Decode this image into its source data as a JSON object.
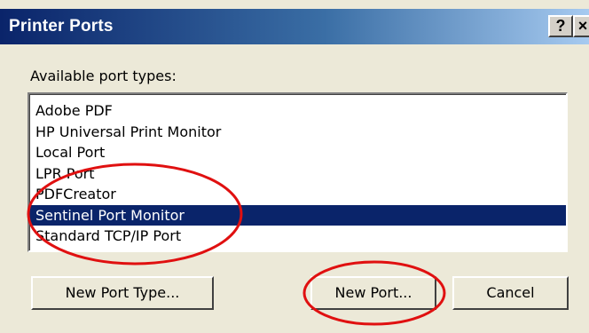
{
  "window": {
    "title": "Printer Ports",
    "help_label": "?",
    "close_label": "×"
  },
  "port_types": {
    "label": "Available port types:",
    "items": [
      "Adobe PDF",
      "HP Universal Print Monitor",
      "Local Port",
      "LPR Port",
      "PDFCreator",
      "Sentinel Port Monitor",
      "Standard TCP/IP Port"
    ],
    "selected": "Sentinel Port Monitor"
  },
  "buttons": {
    "new_port_type": "New Port Type...",
    "new_port": "New Port...",
    "cancel": "Cancel"
  },
  "colors": {
    "selection": "#0a246a",
    "annotation": "#e01010"
  }
}
